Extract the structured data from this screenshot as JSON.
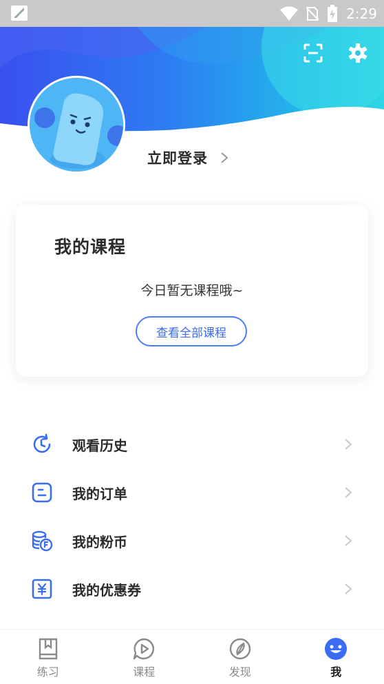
{
  "status_bar": {
    "time": "2:29"
  },
  "header": {
    "login_label": "立即登录"
  },
  "course_card": {
    "title": "我的课程",
    "empty_text": "今日暂无课程哦~",
    "view_all_label": "查看全部课程"
  },
  "menu": {
    "items": [
      {
        "label": "观看历史",
        "icon": "clock-history-icon"
      },
      {
        "label": "我的订单",
        "icon": "order-icon"
      },
      {
        "label": "我的粉币",
        "icon": "coin-stack-icon"
      },
      {
        "label": "我的优惠券",
        "icon": "coupon-icon"
      }
    ]
  },
  "tabbar": {
    "tabs": [
      {
        "label": "练习",
        "icon": "book-icon"
      },
      {
        "label": "课程",
        "icon": "play-icon"
      },
      {
        "label": "发现",
        "icon": "compass-icon"
      },
      {
        "label": "我",
        "icon": "smiley-icon",
        "active": true
      }
    ]
  },
  "colors": {
    "accent": "#3a6cf4",
    "hero_start": "#3a56f0",
    "hero_end": "#2ed3e8"
  }
}
